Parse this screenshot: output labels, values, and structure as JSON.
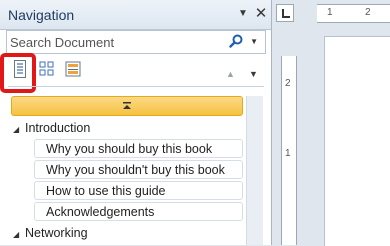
{
  "pane": {
    "title": "Navigation",
    "dropdown_icon": "chevron-down-icon",
    "close_icon": "close-icon"
  },
  "search": {
    "placeholder": "Search Document",
    "icon": "magnifier-icon"
  },
  "tabs": [
    {
      "name": "browse-headings",
      "icon": "headings-page-icon",
      "active": true
    },
    {
      "name": "browse-pages",
      "icon": "thumbnails-icon",
      "active": false
    },
    {
      "name": "browse-results",
      "icon": "results-icon",
      "active": false
    }
  ],
  "nav": {
    "prev_icon": "triangle-up-icon",
    "next_icon": "triangle-down-icon"
  },
  "headings": [
    {
      "label": "Introduction",
      "level": 1,
      "expanded": true
    },
    {
      "label": "Why you should buy this book",
      "level": 2
    },
    {
      "label": "Why you shouldn't buy this book",
      "level": 2
    },
    {
      "label": "How to use this guide",
      "level": 2
    },
    {
      "label": "Acknowledgements",
      "level": 2
    },
    {
      "label": "Networking",
      "level": 1,
      "expanded": true
    }
  ],
  "ruler": {
    "h_marks": [
      "1",
      "2"
    ],
    "v_marks": [
      "2",
      "1"
    ]
  },
  "colors": {
    "highlight": "#e01818",
    "collapse_bar": "#f5c241"
  }
}
